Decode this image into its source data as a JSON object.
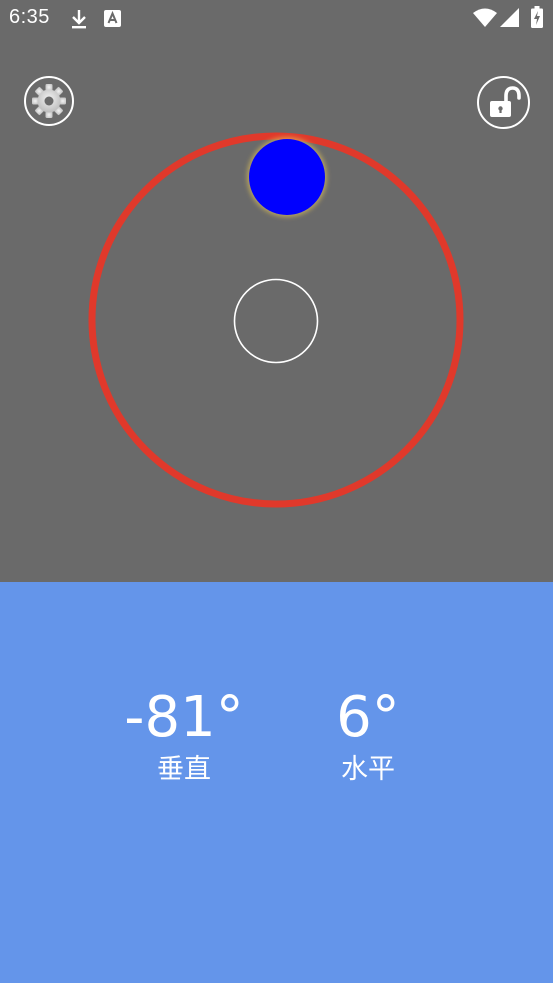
{
  "status_bar": {
    "time": "6:35",
    "icons": [
      "download-icon",
      "text-a-icon",
      "wifi-icon",
      "signal-icon",
      "battery-charging-icon"
    ]
  },
  "toolbar": {
    "settings_icon": "gear-icon",
    "lock_icon": "unlock-icon"
  },
  "level": {
    "outer_ring_color": "#e0392b",
    "bubble_color": "#0000ff",
    "center_marker_color": "#ffffff"
  },
  "readings": {
    "vertical": {
      "value": "-81°",
      "label": "垂直"
    },
    "horizontal": {
      "value": "6°",
      "label": "水平"
    }
  },
  "colors": {
    "background": "#6a6a6a",
    "panel": "#6495ea",
    "text": "#ffffff"
  }
}
